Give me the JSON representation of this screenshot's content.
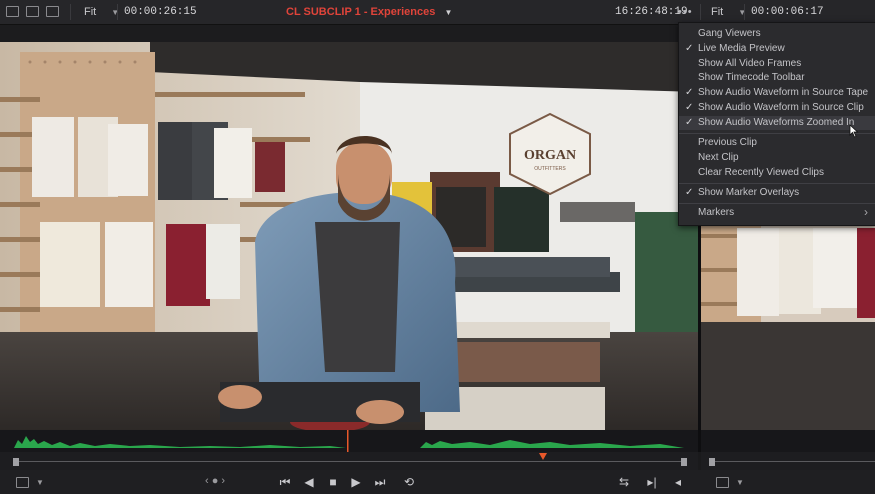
{
  "left_viewer": {
    "zoom": "Fit",
    "timecode_duration": "00:00:26:15",
    "clip_title": "CL SUBCLIP 1 - Experiences",
    "timecode_current": "16:26:48:19"
  },
  "right_viewer": {
    "zoom": "Fit",
    "timecode": "00:00:06:17"
  },
  "colors": {
    "title_red": "#e0443a",
    "playhead_orange": "#e8582a",
    "waveform_green": "#2aa64c",
    "menu_bg": "#2b2b2e"
  },
  "menu": {
    "items": [
      {
        "label": "Gang Viewers",
        "checked": false
      },
      {
        "label": "Live Media Preview",
        "checked": true
      },
      {
        "label": "Show All Video Frames",
        "checked": false
      },
      {
        "label": "Show Timecode Toolbar",
        "checked": false
      },
      {
        "label": "Show Audio Waveform in Source Tape",
        "checked": true
      },
      {
        "label": "Show Audio Waveform in Source Clip",
        "checked": true
      },
      {
        "label": "Show Audio Waveforms Zoomed In",
        "checked": true
      },
      {
        "label": "Previous Clip",
        "checked": false
      },
      {
        "label": "Next Clip",
        "checked": false
      },
      {
        "label": "Clear Recently Viewed Clips",
        "checked": false
      },
      {
        "label": "Show Marker Overlays",
        "checked": true
      },
      {
        "label": "Markers",
        "checked": false
      }
    ],
    "check_glyph": "✓",
    "submenu_glyph": "›"
  },
  "scene": {
    "sign_main": "ORGAN",
    "sign_sub": "OUTFITTERS"
  },
  "icons": {
    "more": "more-horizontal-icon",
    "transport": [
      "jump-start-icon",
      "step-back-icon",
      "stop-icon",
      "play-icon",
      "jump-end-icon",
      "loop-icon"
    ]
  }
}
